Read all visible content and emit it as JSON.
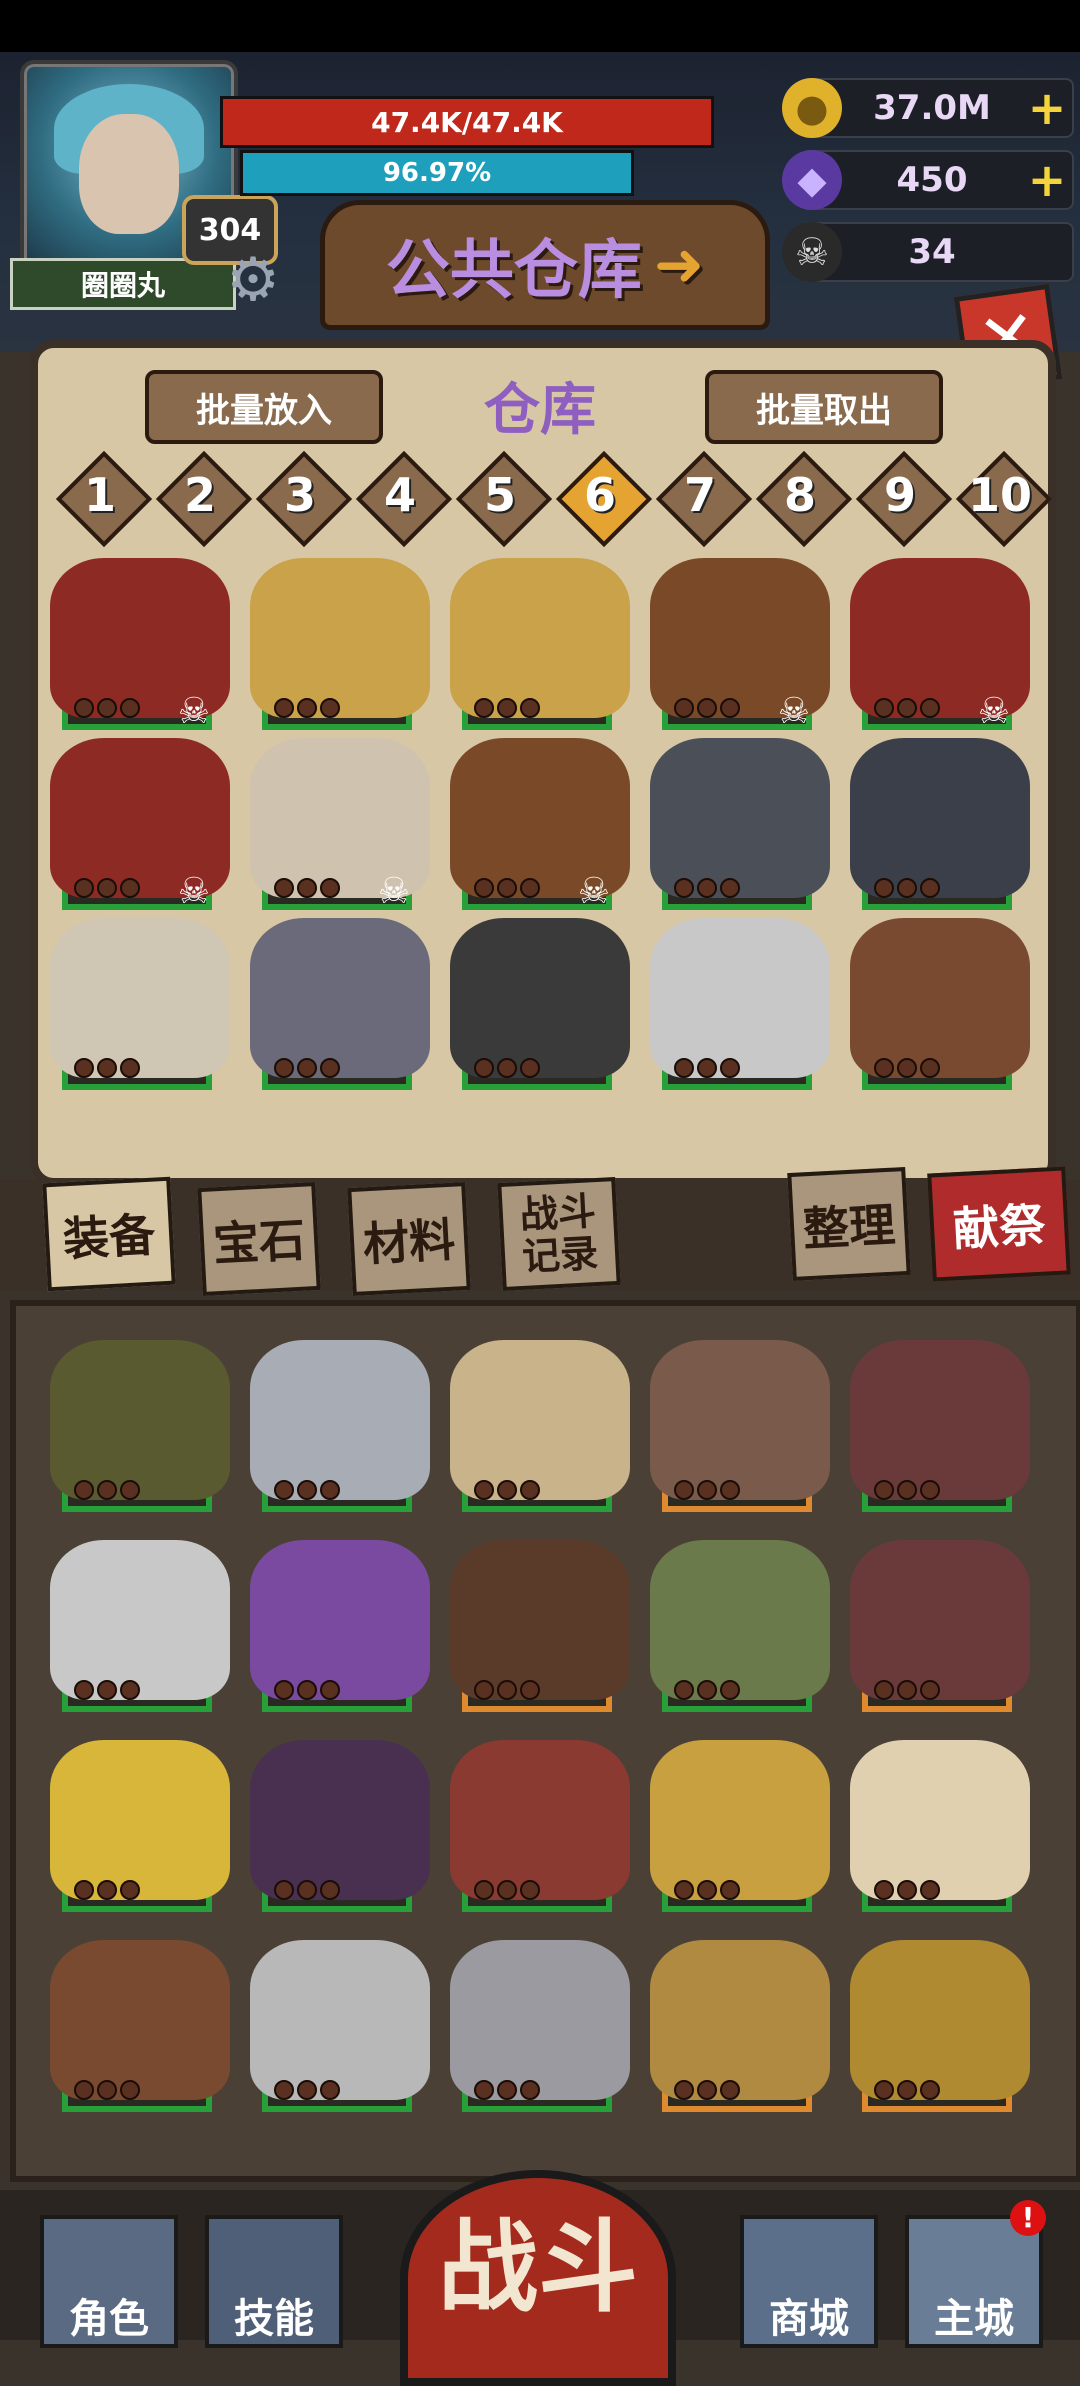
{
  "player": {
    "name": "圈圈丸",
    "level": "304",
    "hp": "47.4K/47.4K",
    "mp": "96.97%"
  },
  "resources": {
    "gold": "37.0M",
    "crystal": "450",
    "skull": "34"
  },
  "store": {
    "title": "公共仓库"
  },
  "warehouse": {
    "title": "仓库",
    "bulk_put": "批量放入",
    "bulk_take": "批量取出",
    "pages": [
      "1",
      "2",
      "3",
      "4",
      "5",
      "6",
      "7",
      "8",
      "9",
      "10"
    ],
    "selected_page": "6"
  },
  "tabs": {
    "equipment": "装备",
    "gems": "宝石",
    "materials": "材料",
    "battle_log": "战斗\n记录",
    "sort": "整理",
    "sacrifice": "献祭"
  },
  "nav": {
    "character": "角色",
    "skills": "技能",
    "fight": "战斗",
    "shop": "商城",
    "main_city": "主城",
    "notice": "!"
  },
  "colors": {
    "hp": "#c0281c",
    "mp": "#1ea0bd",
    "slot_green": "#28a03a",
    "slot_orange": "#e08a30",
    "accent_purple": "#8e5fc0"
  }
}
